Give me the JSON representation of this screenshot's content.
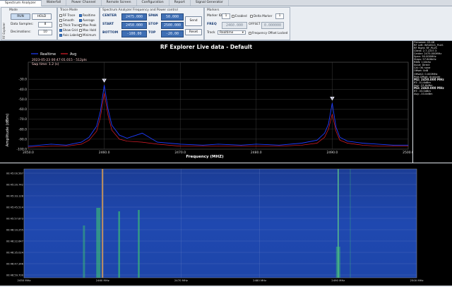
{
  "tabs": [
    "Spectrum Analyzer",
    "Waterfall",
    "Power Channel",
    "Remote Screen",
    "Configuration",
    "Report",
    "Signal Generator"
  ],
  "mode": {
    "title": "Mode",
    "run_label": "RUN",
    "hold_label": "HOLD",
    "data_samples_label": "Data Samples:",
    "data_samples_value": "8",
    "decimations_label": "Decimations:",
    "decimations_value": "10",
    "side_label": "RF Explorer"
  },
  "trace_mode": {
    "title": "Trace Mode",
    "options": [
      {
        "label": "RF Trace",
        "checked": false
      },
      {
        "label": "Smooth",
        "checked": false
      },
      {
        "label": "Thick Trace",
        "checked": false
      },
      {
        "label": "Show Grid",
        "checked": true
      },
      {
        "label": "Axis Labels",
        "checked": true
      }
    ],
    "views": [
      {
        "label": "Realtime",
        "checked": true
      },
      {
        "label": "Average",
        "checked": true
      },
      {
        "label": "Max Peak",
        "checked": false
      },
      {
        "label": "Max Hold",
        "checked": false
      },
      {
        "label": "Minimum",
        "checked": false
      }
    ]
  },
  "freq_control": {
    "title": "Spectrum Analyzer Frequency and Power control",
    "center_label": "CENTER",
    "center_value": "2475.000",
    "start_label": "START",
    "start_value": "2450.000",
    "bottom_label": "BOTTOM",
    "bottom_value": "-100.00",
    "span_label": "SPAN",
    "span_value": "50.000",
    "stop_label": "STOP",
    "stop_value": "2500.000",
    "top_label": "TOP",
    "top_value": "-20.00",
    "send_label": "Send",
    "reset_label": "Reset"
  },
  "markers": {
    "title": "Markers",
    "marker_id_label": "Marker ID",
    "marker_id_value": "1",
    "enabled_label": "Enabled",
    "delta_marker_label": "Delta Marker",
    "delta_marker_value": "1",
    "freq_label": "FREQ",
    "freq_value": "2460.000",
    "offset_label": "OFFSET",
    "offset_value": "0.000000",
    "track_label": "Track",
    "track_value": "Realtime",
    "freq_offset_locked_label": "Frequency Offset Locked"
  },
  "chart_data": {
    "type": "line",
    "title": "RF Explorer Live data - Default",
    "timestamp": "2023-05-23 00:47:01.015 - 512pts",
    "sweep_time": "Swp time: 1.2 (s)",
    "xlabel": "Frequency (MHZ)",
    "ylabel": "Amplitude (dBm)",
    "xlim": [
      2450,
      2500
    ],
    "ylim": [
      -100,
      -20
    ],
    "x_ticks": [
      "2450.0",
      "2460.0",
      "2470.0",
      "2480.0",
      "2490.0",
      "2500.0"
    ],
    "y_ticks": [
      "-30.0",
      "-40.0",
      "-50.0",
      "-60.0",
      "-70.0",
      "-80.0",
      "-90.0",
      "-100.0"
    ],
    "legend": "top-left",
    "grid": true,
    "colors": {
      "realtime": "#1e3cff",
      "avg": "#e01e2a"
    },
    "series": [
      {
        "name": "Realtime",
        "x": [
          2450,
          2453,
          2455,
          2457,
          2458,
          2459,
          2459.5,
          2460,
          2460.5,
          2461,
          2462,
          2463,
          2465,
          2467,
          2470,
          2473,
          2475,
          2478,
          2480,
          2483,
          2486,
          2488,
          2489,
          2489.5,
          2490,
          2490.5,
          2491,
          2492,
          2494,
          2496,
          2498,
          2500
        ],
        "values": [
          -97,
          -95,
          -96,
          -93,
          -88,
          -77,
          -62,
          -36,
          -60,
          -76,
          -86,
          -89,
          -84,
          -93,
          -95,
          -96,
          -95,
          -96,
          -95,
          -96,
          -94,
          -91,
          -84,
          -75,
          -54,
          -78,
          -88,
          -92,
          -94,
          -95,
          -96,
          -96
        ]
      },
      {
        "name": "Avg",
        "x": [
          2450,
          2453,
          2455,
          2457,
          2458,
          2459,
          2459.5,
          2460,
          2460.5,
          2461,
          2462,
          2463,
          2465,
          2467,
          2470,
          2473,
          2475,
          2478,
          2480,
          2483,
          2486,
          2488,
          2489,
          2489.5,
          2490,
          2490.5,
          2491,
          2492,
          2494,
          2496,
          2498,
          2500
        ],
        "values": [
          -98,
          -97,
          -97,
          -95,
          -91,
          -82,
          -68,
          -44,
          -66,
          -81,
          -90,
          -92,
          -93,
          -95,
          -97,
          -97,
          -97,
          -97,
          -97,
          -97,
          -96,
          -94,
          -88,
          -80,
          -65,
          -82,
          -91,
          -94,
          -96,
          -97,
          -97,
          -97
        ]
      }
    ],
    "markers": [
      {
        "id": "1",
        "x": 2460,
        "y": -36
      },
      {
        "id": "2",
        "x": 2490,
        "y": -54
      }
    ]
  },
  "side_panel": [
    "Firmware: 03.46",
    "RF Left: WSUB1G_PLUS",
    "RF Right: RF_PLUS",
    "Client: 2.7.2207.3",
    "Center: 2475.000MHz",
    "Span: 50.000MHz",
    "Steps: 97.848kHz",
    "RBW: 110kHz",
    "Input: Direct",
    "Cal: OK none",
    "Offset: 0dB",
    "Offset2: 0.000MHz",
    "Pres.Offset: Analyzer"
  ],
  "side_markers": [
    {
      "head": "M2: 2450.000 MHz",
      "rt": "RT: -51.6dBm",
      "avg": "Avg: -51.6dBm"
    },
    {
      "head": "M3: 2460.000 MHz",
      "rt": "RT: -33.0dBm",
      "avg": "Avg: -33.0dBm"
    }
  ],
  "waterfall": {
    "time_labels": [
      "00:45:00.567",
      "00:45:20.742",
      "00:45:33.128",
      "00:45:45.514",
      "00:45:57.873",
      "00:46:10.255",
      "00:46:22.647",
      "00:46:35.024",
      "00:46:47.346",
      "00:46:59.700"
    ],
    "freq_labels": [
      "2450 MHz",
      "2460 MHz",
      "2470 MHz",
      "2480 MHz",
      "2490 MHz",
      "2500 MHz"
    ]
  }
}
